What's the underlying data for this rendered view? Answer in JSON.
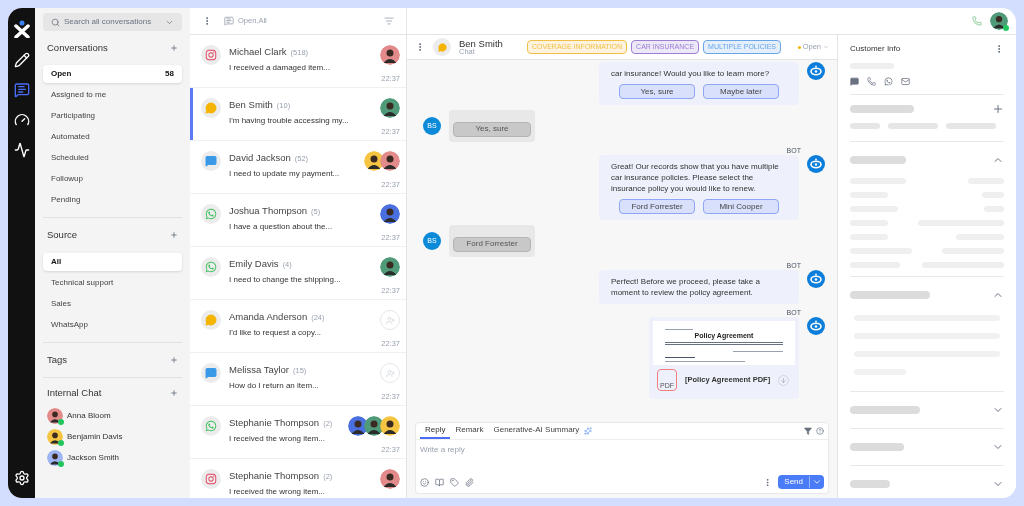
{
  "rail": [
    {
      "kind": "logo",
      "selected": false
    },
    {
      "kind": "pencil",
      "selected": false
    },
    {
      "kind": "chat",
      "selected": true
    },
    {
      "kind": "gauge",
      "selected": false
    },
    {
      "kind": "trend",
      "selected": false
    },
    {
      "kind": "settings",
      "selected": false
    }
  ],
  "search": {
    "placeholder": "Search all conversations"
  },
  "sections": [
    {
      "title": "Conversations",
      "items": [
        {
          "label": "Open",
          "count": "58",
          "selected": true
        },
        {
          "label": "Assigned to me",
          "selected": false
        },
        {
          "label": "Participating",
          "selected": false
        },
        {
          "label": "Automated",
          "selected": false
        },
        {
          "label": "Scheduled",
          "selected": false
        },
        {
          "label": "Followup",
          "selected": false
        },
        {
          "label": "Pending",
          "selected": false
        }
      ]
    },
    {
      "title": "Source",
      "items": [
        {
          "label": "All",
          "selected": true
        },
        {
          "label": "Technical support",
          "selected": false
        },
        {
          "label": "Sales",
          "selected": false
        },
        {
          "label": "WhatsApp",
          "selected": false
        }
      ]
    },
    {
      "title": "Tags"
    }
  ],
  "internal_chat": {
    "title": "Internal Chat",
    "members": [
      {
        "name": "Anna Bloom",
        "color": "#e38b8b",
        "online": true
      },
      {
        "name": "Benjamin Davis",
        "color": "#f5c542",
        "online": true
      },
      {
        "name": "Jackson Smith",
        "color": "#9db4f5",
        "online": true
      }
    ]
  },
  "list_header": {
    "filter": "Open,All"
  },
  "conversations": [
    {
      "name": "Michael Clark",
      "count": "(518)",
      "preview": "I received a damaged item...",
      "time": "22:37",
      "kind": "instagram",
      "selected": false,
      "assignees": [
        {
          "color": "#e38b8b"
        }
      ]
    },
    {
      "name": "Ben Smith",
      "count": "(10)",
      "preview": "I'm having trouble accessing my...",
      "time": "22:37",
      "kind": "livechat",
      "selected": true,
      "assignees": [
        {
          "color": "#4f9a78"
        }
      ]
    },
    {
      "name": "David Jackson",
      "count": "(52)",
      "preview": "I need to update my payment...",
      "time": "22:37",
      "kind": "messenger",
      "selected": false,
      "assignees": [
        {
          "color": "#f5c542"
        },
        {
          "color": "#e38b8b"
        }
      ]
    },
    {
      "name": "Joshua Thompson",
      "count": "(5)",
      "preview": "I have a question about the...",
      "time": "22:37",
      "kind": "whatsapp",
      "selected": false,
      "assignees": [
        {
          "color": "#4a6fe0"
        }
      ]
    },
    {
      "name": "Emily Davis",
      "count": "(4)",
      "preview": "I need to change the shipping...",
      "time": "22:37",
      "kind": "whatsapp",
      "selected": false,
      "assignees": [
        {
          "color": "#4f9a78"
        }
      ]
    },
    {
      "name": "Amanda Anderson",
      "count": "(24)",
      "preview": "I'd like to request a copy...",
      "time": "22:37",
      "kind": "livechat",
      "selected": false
    },
    {
      "name": "Melissa Taylor",
      "count": "(15)",
      "preview": "How do I return an item...",
      "time": "22:37",
      "kind": "messenger",
      "selected": false
    },
    {
      "name": "Stephanie Thompson",
      "count": "(2)",
      "preview": "I received the wrong item...",
      "time": "22:37",
      "kind": "whatsapp",
      "selected": false,
      "assignees": [
        {
          "color": "#4a6fe0"
        },
        {
          "color": "#4f9a78"
        },
        {
          "color": "#f5c542"
        }
      ]
    },
    {
      "name": "Stephanie Thompson",
      "count": "(2)",
      "preview": "I received the wrong item...",
      "kind": "instagram",
      "selected": false,
      "assignees": [
        {
          "color": "#e38b8b"
        }
      ]
    }
  ],
  "chat": {
    "name": "Ben Smith",
    "subtitle": "Chat",
    "status": "Open",
    "tags": [
      {
        "label": "COVERAGE INFORMATION",
        "color": "#f2bf45"
      },
      {
        "label": "CAR INSURANCE",
        "color": "#9a7ed3"
      },
      {
        "label": "MULTIPLE POLICIES",
        "color": "#68a6e8"
      }
    ],
    "messages": [
      {
        "kind": "bot",
        "text": "car insurance! Would you like to learn more?",
        "options": [
          "Yes, sure",
          "Maybe later"
        ]
      },
      {
        "kind": "user",
        "initials": "BS",
        "text": "Yes, sure"
      },
      {
        "kind": "bot",
        "label": "BOT",
        "text": "Great! Our records show that you have multiple car insurance policies. Please select the insurance policy you would like to renew.",
        "options": [
          "Ford Forrester",
          "Mini Cooper"
        ]
      },
      {
        "kind": "user",
        "initials": "BS",
        "text": "Ford Forrester"
      },
      {
        "kind": "bot",
        "label": "BOT",
        "text": "Perfect! Before we proceed, please take a moment to review the policy agreement."
      },
      {
        "kind": "document",
        "label": "BOT",
        "title": "Policy Agreement",
        "file_badge": "PDF",
        "file_name": "[Policy Agreement PDF]"
      }
    ]
  },
  "composer": {
    "tabs": [
      {
        "label": "Reply",
        "selected": true
      },
      {
        "label": "Remark",
        "selected": false
      },
      {
        "label": "Generative-AI Summary",
        "selected": false
      }
    ],
    "placeholder": "Write a reply",
    "send": "Send"
  },
  "customer_info": {
    "title": "Customer Info"
  }
}
